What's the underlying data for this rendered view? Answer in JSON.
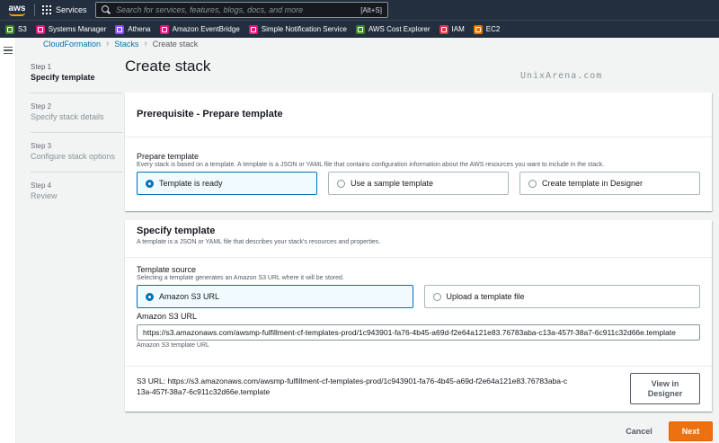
{
  "topnav": {
    "logo_text": "aws",
    "services_label": "Services",
    "search_placeholder": "Search for services, features, blogs, docs, and more",
    "search_shortcut": "[Alt+S]"
  },
  "favorites": [
    {
      "label": "S3",
      "color": "#3f8624"
    },
    {
      "label": "Systems Manager",
      "color": "#e7157b"
    },
    {
      "label": "Athena",
      "color": "#8c4fff"
    },
    {
      "label": "Amazon EventBridge",
      "color": "#e7157b"
    },
    {
      "label": "Simple Notification Service",
      "color": "#e7157b"
    },
    {
      "label": "AWS Cost Explorer",
      "color": "#3f8624"
    },
    {
      "label": "IAM",
      "color": "#dd344c"
    },
    {
      "label": "EC2",
      "color": "#ed7100"
    }
  ],
  "breadcrumb": {
    "items": [
      "CloudFormation",
      "Stacks"
    ],
    "current": "Create stack"
  },
  "steps": [
    {
      "num": "Step 1",
      "name": "Specify template"
    },
    {
      "num": "Step 2",
      "name": "Specify stack details"
    },
    {
      "num": "Step 3",
      "name": "Configure stack options"
    },
    {
      "num": "Step 4",
      "name": "Review"
    }
  ],
  "page_title": "Create stack",
  "watermark": "UnixArena.com",
  "prerequisite": {
    "heading": "Prerequisite - Prepare template",
    "label": "Prepare template",
    "hint": "Every stack is based on a template. A template is a JSON or YAML file that contains configuration information about the AWS resources you want to include in the stack.",
    "options": [
      "Template is ready",
      "Use a sample template",
      "Create template in Designer"
    ],
    "selected": "Template is ready"
  },
  "specify": {
    "heading": "Specify template",
    "description": "A template is a JSON or YAML file that describes your stack's resources and properties.",
    "source_label": "Template source",
    "source_hint": "Selecting a template generates an Amazon S3 URL where it will be stored.",
    "source_options": [
      "Amazon S3 URL",
      "Upload a template file"
    ],
    "selected_source": "Amazon S3 URL",
    "url_label": "Amazon S3 URL",
    "url_value": "https://s3.amazonaws.com/awsmp-fulfillment-cf-templates-prod/1c943901-fa76-4b45-a69d-f2e64a121e83.76783aba-c13a-457f-38a7-6c911c32d66e.template",
    "url_hint": "Amazon S3 template URL",
    "s3_url_line1": "S3 URL:  https://s3.amazonaws.com/awsmp-fulfillment-cf-templates-prod/1c943901-fa76-4b45-a69d-f2e64a121e83.76783aba-c",
    "s3_url_line2": "13a-457f-38a7-6c911c32d66e.template",
    "view_button_line1": "View in",
    "view_button_line2": "Designer"
  },
  "footer": {
    "cancel": "Cancel",
    "next": "Next"
  }
}
